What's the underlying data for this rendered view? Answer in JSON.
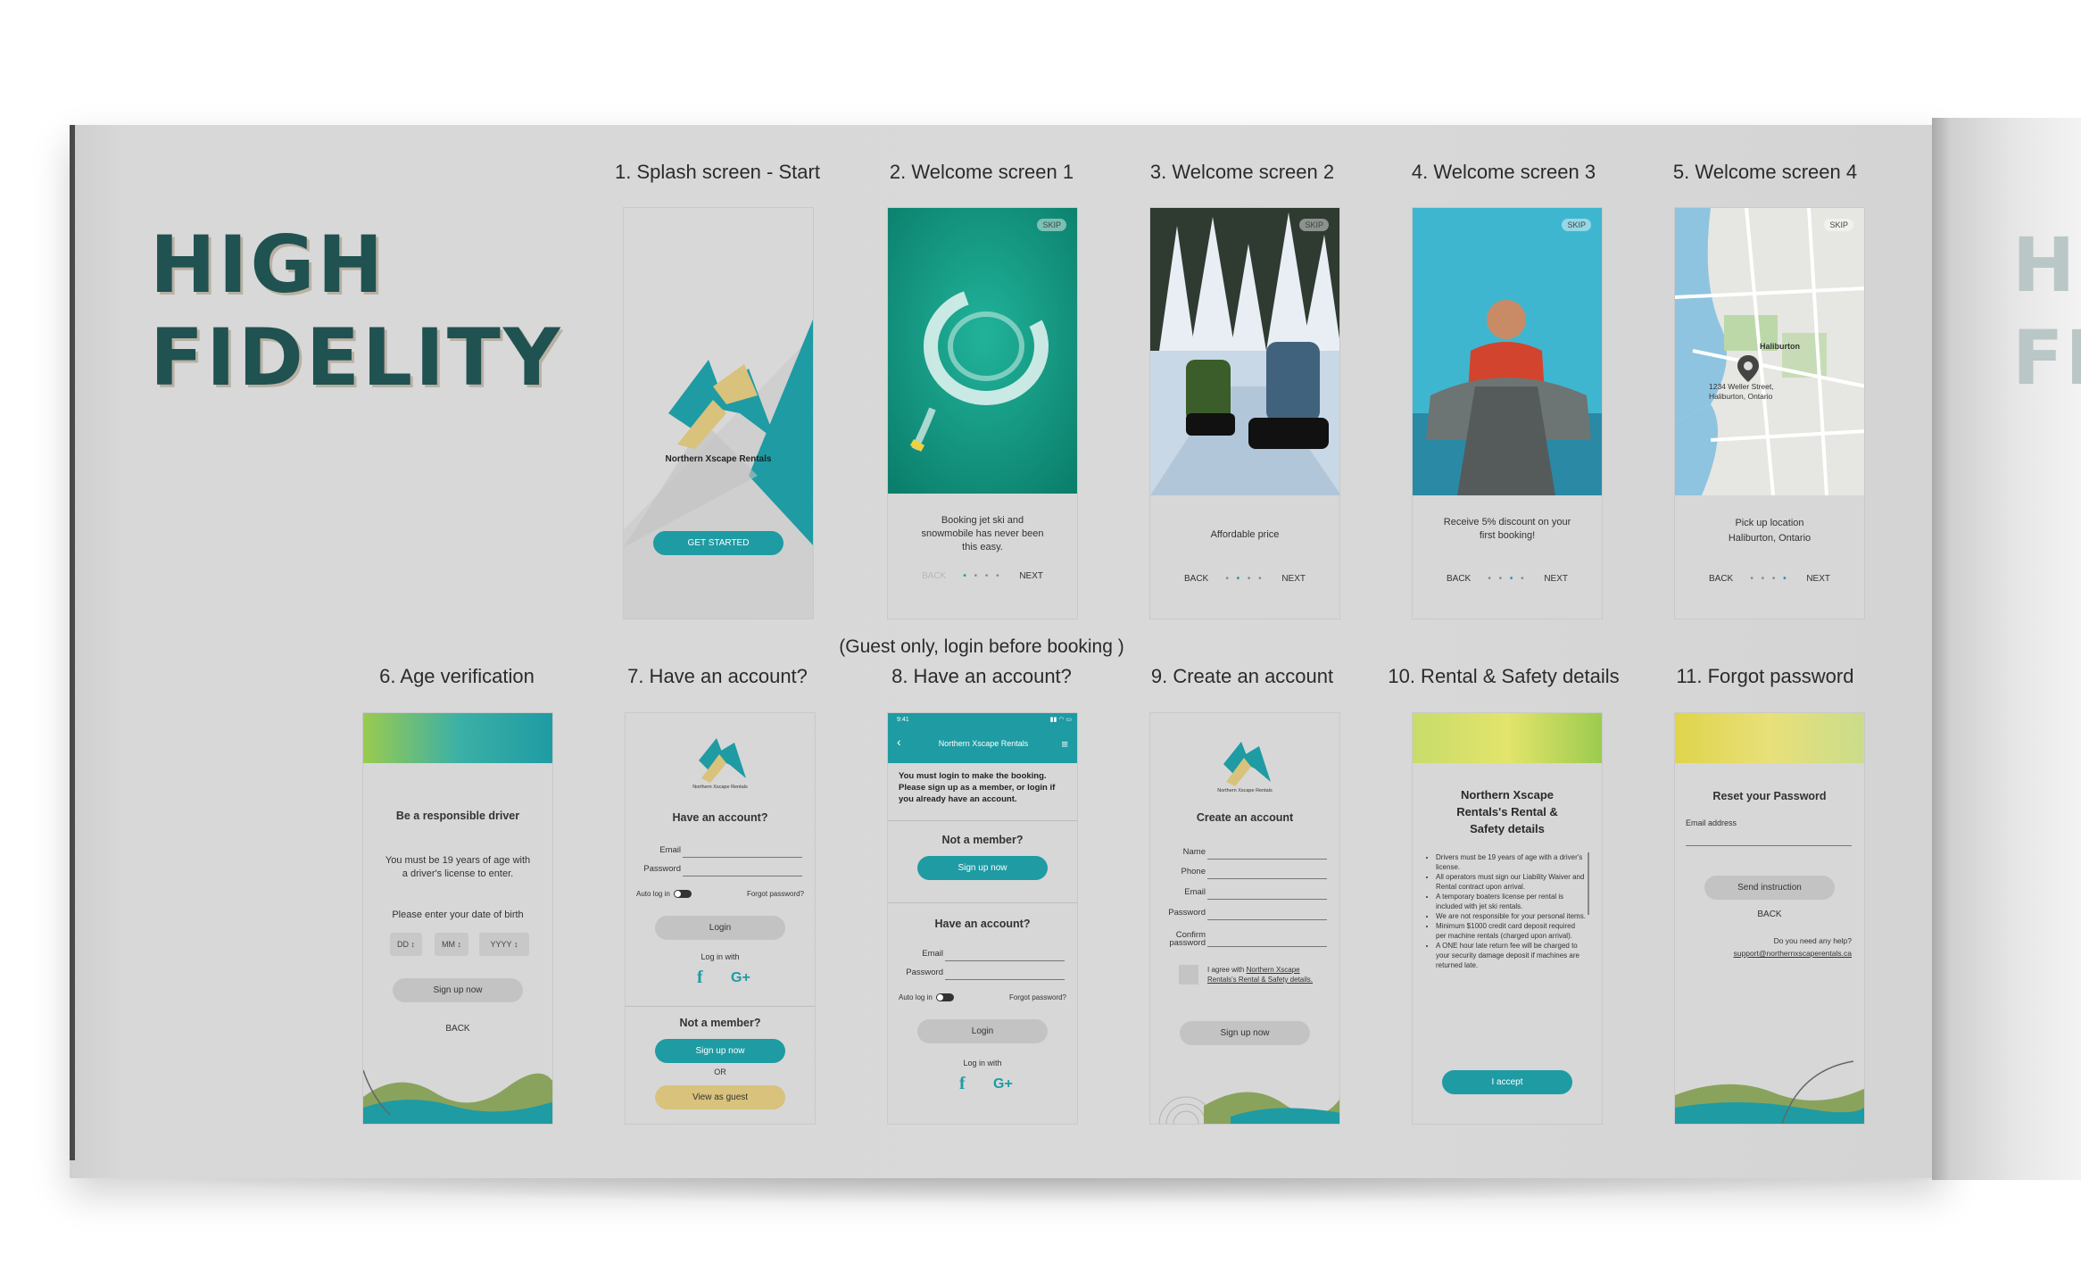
{
  "title": {
    "line1": "HIGH",
    "line2": "FIDELITY"
  },
  "next_page_title": {
    "line1": "HI",
    "line2": "FI"
  },
  "note": "(Guest only, login before booking )",
  "screens": {
    "s1": {
      "label": "1. Splash screen - Start",
      "brand": "Northern Xscape Rentals",
      "button": "GET STARTED"
    },
    "s2": {
      "label": "2. Welcome screen 1",
      "skip": "SKIP",
      "text": "Booking jet ski and snowmobile has never been this easy.",
      "back": "BACK",
      "next": "NEXT",
      "dots": "• • • •"
    },
    "s3": {
      "label": "3. Welcome screen 2",
      "skip": "SKIP",
      "text": "Affordable price",
      "back": "BACK",
      "next": "NEXT",
      "dots": "• • • •"
    },
    "s4": {
      "label": "4. Welcome screen 3",
      "skip": "SKIP",
      "text": "Receive 5% discount on your first booking!",
      "back": "BACK",
      "next": "NEXT",
      "dots": "• • • •"
    },
    "s5": {
      "label": "5. Welcome screen 4",
      "skip": "SKIP",
      "map_city": "Haliburton",
      "map_address": "1234 Weller Street, Haliburton, Ontario",
      "text1": "Pick up location",
      "text2": "Haliburton, Ontario",
      "back": "BACK",
      "next": "NEXT",
      "dots": "• • • •"
    },
    "s6": {
      "label": "6. Age verification",
      "heading": "Be a responsible driver",
      "text": "You must be 19 years of age with a driver's license to enter.",
      "prompt": "Please enter your date of birth",
      "dd": "DD",
      "mm": "MM",
      "yyyy": "YYYY",
      "button": "Sign up now",
      "back": "BACK"
    },
    "s7": {
      "label": "7. Have an account?",
      "logo_text": "Northern Xscape Rentals",
      "heading": "Have an account?",
      "email": "Email",
      "password": "Password",
      "auto": "Auto log in",
      "forgot": "Forgot password?",
      "login": "Login",
      "login_with": "Log in with",
      "not_member": "Not a member?",
      "signup": "Sign up now",
      "or": "OR",
      "guest": "View as guest"
    },
    "s8": {
      "label": "8. Have an account?",
      "status_time": "9:41",
      "bar_title": "Northern Xscape Rentals",
      "message": "You must login to make the booking. Please sign up as a member, or login if you already have an account.",
      "not_member": "Not a member?",
      "signup": "Sign up now",
      "heading": "Have an account?",
      "email": "Email",
      "password": "Password",
      "auto": "Auto log in",
      "forgot": "Forgot password?",
      "login": "Login",
      "login_with": "Log in with"
    },
    "s9": {
      "label": "9. Create an account",
      "logo_text": "Northern Xscape Rentals",
      "heading": "Create an account",
      "name": "Name",
      "phone": "Phone",
      "email": "Email",
      "password": "Password",
      "confirm": "Confirm password",
      "agree": "I agree with",
      "agree_link": "Northern Xscape Rentals's Rental & Safety details.",
      "button": "Sign up now"
    },
    "s10": {
      "label": "10. Rental & Safety details",
      "heading": "Northern Xscape Rentals's Rental & Safety details",
      "items": [
        "Drivers must be 19 years of age with a driver's license.",
        "All operators must sign our Liability Waiver and Rental contract upon arrival.",
        "A temporary boaters license per rental is included with jet ski rentals.",
        "We are not responsible for your personal items.",
        "Minimum $1000 credit card deposit required per machine rentals (charged upon arrival).",
        "A ONE hour late return fee will be charged to your security damage deposit if machines are returned late."
      ],
      "button": "I accept"
    },
    "s11": {
      "label": "11. Forgot password",
      "heading": "Reset your Password",
      "email": "Email address",
      "button": "Send instruction",
      "back": "BACK",
      "help": "Do you need any help?",
      "support": "support@northernxscaperentals.ca"
    }
  },
  "colors": {
    "teal": "#1e9ba3",
    "dark_teal": "#1f5250",
    "gold": "#d8c27c",
    "page": "#d9d9d9"
  }
}
